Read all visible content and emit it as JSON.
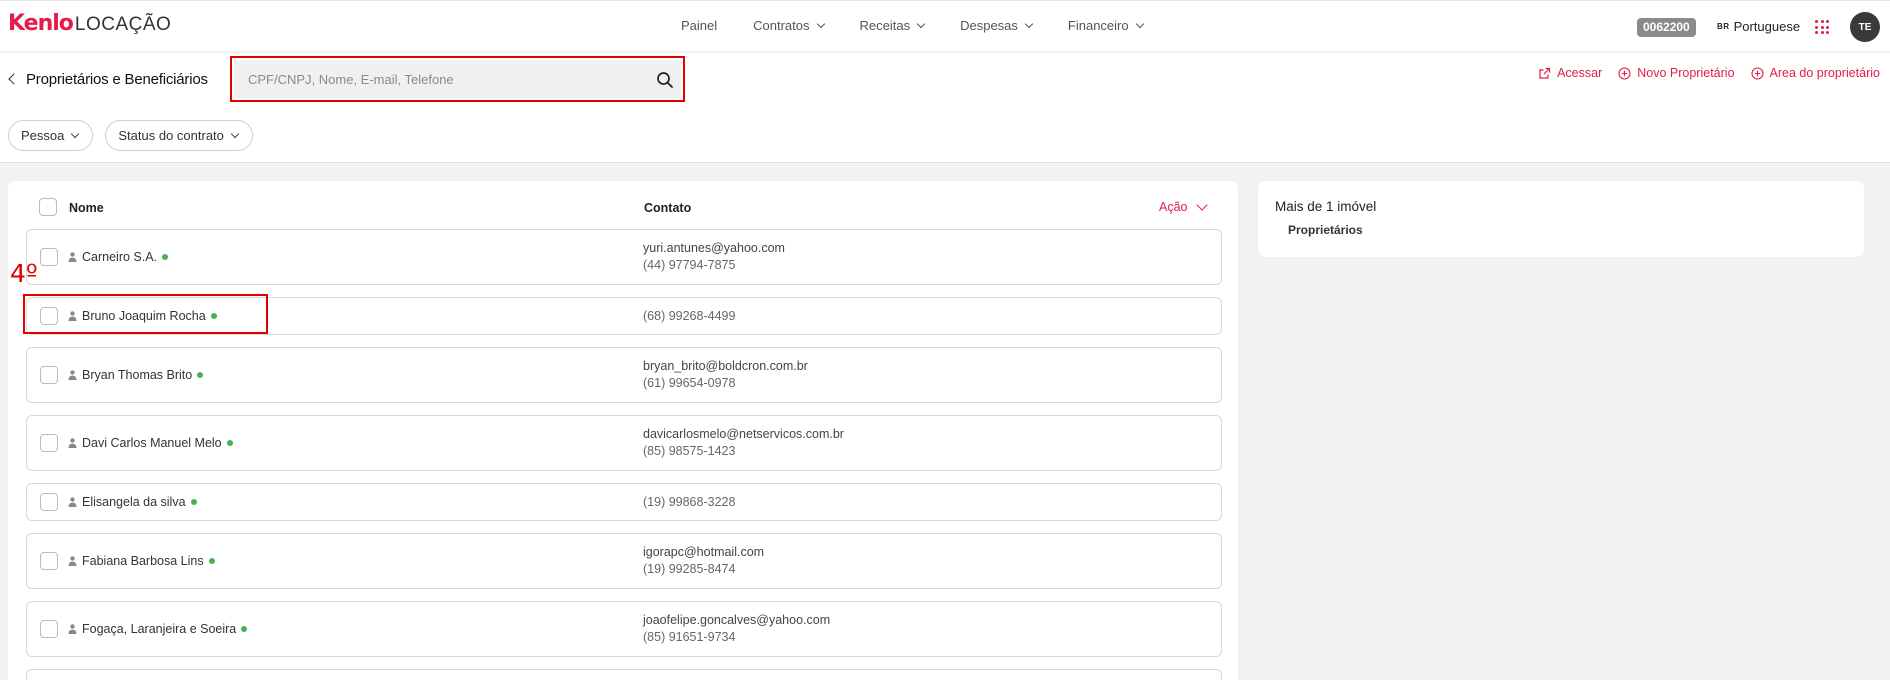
{
  "brand": {
    "logo_main": "Kenlo",
    "logo_sub": "LOCAÇÃO"
  },
  "nav": {
    "items": [
      {
        "label": "Painel",
        "has_dropdown": false
      },
      {
        "label": "Contratos",
        "has_dropdown": true
      },
      {
        "label": "Receitas",
        "has_dropdown": true
      },
      {
        "label": "Despesas",
        "has_dropdown": true
      },
      {
        "label": "Financeiro",
        "has_dropdown": true
      }
    ],
    "account_code": "0062200",
    "language_flag": "BR",
    "language": "Portuguese",
    "avatar_initials": "TE"
  },
  "header": {
    "title": "Proprietários e Beneficiários",
    "search": {
      "placeholder": "CPF/CNPJ, Nome, E-mail, Telefone",
      "value": ""
    },
    "actions": [
      {
        "label": "Acessar",
        "icon": "external-link-icon"
      },
      {
        "label": "Novo Proprietário",
        "icon": "plus-circle-icon"
      },
      {
        "label": "Area do proprietário",
        "icon": "plus-circle-icon"
      }
    ],
    "filters": [
      {
        "label": "Pessoa"
      },
      {
        "label": "Status do contrato"
      }
    ]
  },
  "table": {
    "columns": {
      "name": "Nome",
      "contact": "Contato",
      "action": "Ação"
    },
    "rows": [
      {
        "name": "Carneiro S.A.",
        "email": "yuri.antunes@yahoo.com",
        "phone": "(44) 97794-7875"
      },
      {
        "name": "Bruno Joaquim Rocha",
        "email": "",
        "phone": "(68) 99268-4499"
      },
      {
        "name": "Bryan Thomas Brito",
        "email": "bryan_brito@boldcron.com.br",
        "phone": "(61) 99654-0978"
      },
      {
        "name": "Davi Carlos Manuel Melo",
        "email": "davicarlosmelo@netservicos.com.br",
        "phone": "(85) 98575-1423"
      },
      {
        "name": "Elisangela da silva",
        "email": "",
        "phone": "(19) 99868-3228"
      },
      {
        "name": "Fabiana Barbosa Lins",
        "email": "igorapc@hotmail.com",
        "phone": "(19) 99285-8474"
      },
      {
        "name": "Fogaça, Laranjeira e Soeira",
        "email": "joaofelipe.goncalves@yahoo.com",
        "phone": "(85) 91651-9734"
      }
    ],
    "status_color": "#4caf50"
  },
  "annotation": {
    "label": "4º",
    "color": "#e00000"
  },
  "side_panel": {
    "title": "Mais de 1 imóvel",
    "subtitle": "Proprietários"
  },
  "colors": {
    "accent": "#e11d48",
    "highlight": "#e00000"
  }
}
